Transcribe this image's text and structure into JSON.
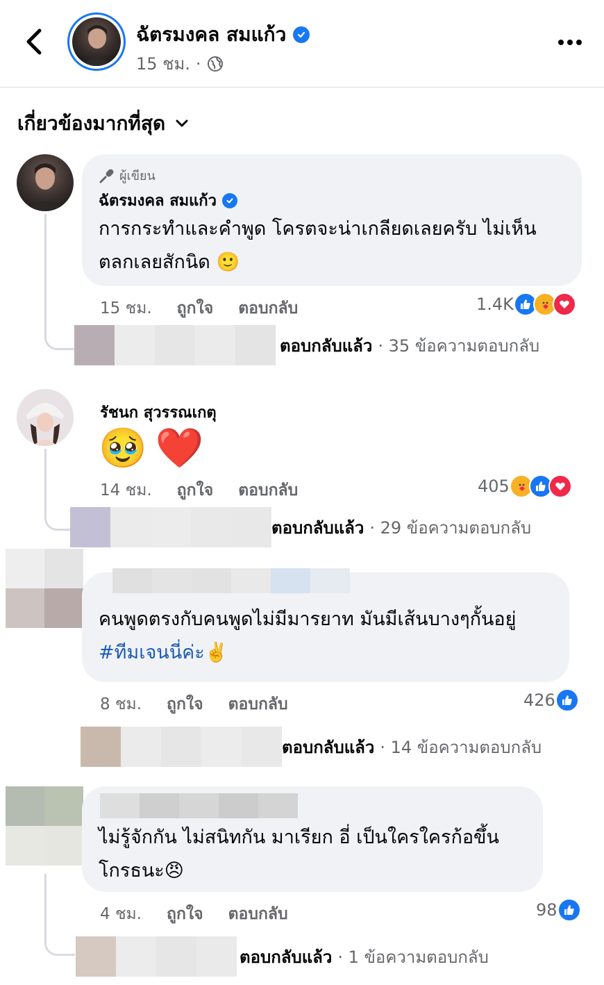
{
  "header": {
    "page_name": "ฉัตรมงคล สมแก้ว",
    "time": "15 ชม.",
    "separator": "·"
  },
  "sort": {
    "label": "เกี่ยวข้องมากที่สุด"
  },
  "comments": [
    {
      "author_badge": "ผู้เขียน",
      "name": "ฉัตรมงคล สมแก้ว",
      "text_line1": "การกระทำและคำพูด โครตจะน่าเกลียดเลยครับ ไม่เห็น",
      "text_line2": "ตลกเลยสักนิด",
      "emoji": "🙂",
      "time": "15 ชม.",
      "like_label": "ถูกใจ",
      "reply_label": "ตอบกลับ",
      "reaction_count": "1.4K",
      "replied_label": "ตอบกลับแล้ว",
      "reply_count": "· 35 ข้อความตอบกลับ"
    },
    {
      "name": "รัชนก สุวรรณเกตุ",
      "emoji1": "🥹",
      "emoji2": "❤️",
      "time": "14 ชม.",
      "like_label": "ถูกใจ",
      "reply_label": "ตอบกลับ",
      "reaction_count": "405",
      "replied_label": "ตอบกลับแล้ว",
      "reply_count": "· 29 ข้อความตอบกลับ"
    },
    {
      "text_line1": "คนพูดตรงกับคนพูดไม่มีมารยาท มันมีเส้นบางๆกั้นอยู่",
      "hashtag": "#ทีมเจนนี่ค่ะ",
      "emoji": "✌️",
      "time": "8 ชม.",
      "like_label": "ถูกใจ",
      "reply_label": "ตอบกลับ",
      "reaction_count": "426",
      "replied_label": "ตอบกลับแล้ว",
      "reply_count": "· 14 ข้อความตอบกลับ"
    },
    {
      "text_line1": "ไม่รู้จักกัน ไม่สนิทกัน มาเรียก อี่ เป็นใครใครก้อขึ้น",
      "text_line2": "โกรธนะ",
      "emoji": "😠",
      "time": "4 ชม.",
      "like_label": "ถูกใจ",
      "reply_label": "ตอบกลับ",
      "reaction_count": "98",
      "replied_label": "ตอบกลับแล้ว",
      "reply_count": "· 1 ข้อความตอบกลับ"
    }
  ],
  "colors": {
    "accent": "#1877f2",
    "bubble": "#f0f2f5",
    "meta": "#65676b",
    "love": "#f02849",
    "hashtag": "#1b5bb6"
  }
}
